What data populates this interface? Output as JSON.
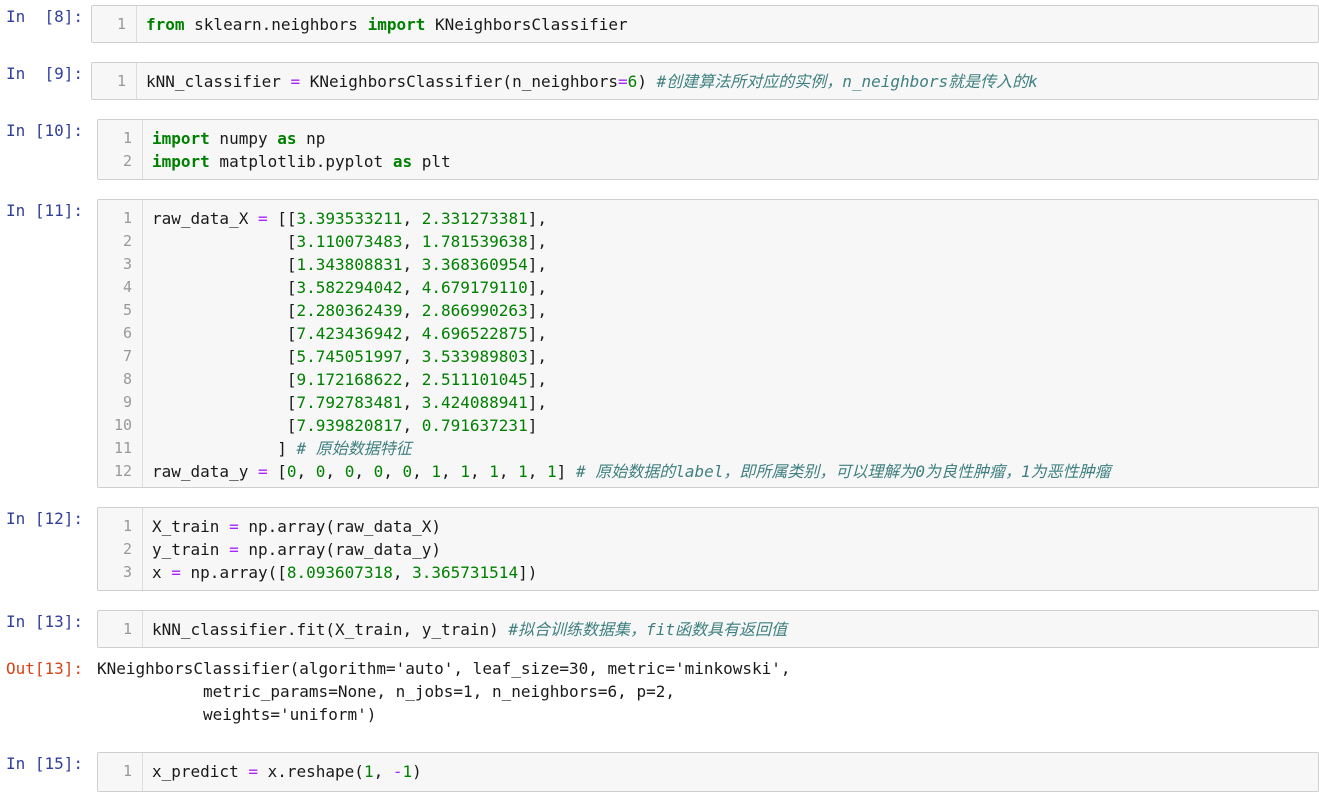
{
  "cells": [
    {
      "prompt": "In  [8]:",
      "lines": [
        [
          {
            "t": "kw",
            "v": "from"
          },
          {
            "t": "pl",
            "v": " sklearn.neighbors "
          },
          {
            "t": "kw",
            "v": "import"
          },
          {
            "t": "pl",
            "v": " KNeighborsClassifier"
          }
        ]
      ]
    },
    {
      "prompt": "In  [9]:",
      "lines": [
        [
          {
            "t": "pl",
            "v": "kNN_classifier "
          },
          {
            "t": "op",
            "v": "="
          },
          {
            "t": "pl",
            "v": " KNeighborsClassifier(n_neighbors"
          },
          {
            "t": "op",
            "v": "="
          },
          {
            "t": "num",
            "v": "6"
          },
          {
            "t": "pl",
            "v": ") "
          },
          {
            "t": "cm",
            "v": "#创建算法所对应的实例，n_neighbors就是传入的k"
          }
        ]
      ]
    },
    {
      "prompt": "In [10]:",
      "lines": [
        [
          {
            "t": "kw",
            "v": "import"
          },
          {
            "t": "pl",
            "v": " numpy "
          },
          {
            "t": "kw",
            "v": "as"
          },
          {
            "t": "pl",
            "v": " np"
          }
        ],
        [
          {
            "t": "kw",
            "v": "import"
          },
          {
            "t": "pl",
            "v": " matplotlib.pyplot "
          },
          {
            "t": "kw",
            "v": "as"
          },
          {
            "t": "pl",
            "v": " plt"
          }
        ]
      ]
    },
    {
      "prompt": "In [11]:",
      "lines": [
        [
          {
            "t": "pl",
            "v": "raw_data_X "
          },
          {
            "t": "op",
            "v": "="
          },
          {
            "t": "pl",
            "v": " [["
          },
          {
            "t": "num",
            "v": "3.393533211"
          },
          {
            "t": "pl",
            "v": ", "
          },
          {
            "t": "num",
            "v": "2.331273381"
          },
          {
            "t": "pl",
            "v": "],"
          }
        ],
        [
          {
            "t": "pl",
            "v": "              ["
          },
          {
            "t": "num",
            "v": "3.110073483"
          },
          {
            "t": "pl",
            "v": ", "
          },
          {
            "t": "num",
            "v": "1.781539638"
          },
          {
            "t": "pl",
            "v": "],"
          }
        ],
        [
          {
            "t": "pl",
            "v": "              ["
          },
          {
            "t": "num",
            "v": "1.343808831"
          },
          {
            "t": "pl",
            "v": ", "
          },
          {
            "t": "num",
            "v": "3.368360954"
          },
          {
            "t": "pl",
            "v": "],"
          }
        ],
        [
          {
            "t": "pl",
            "v": "              ["
          },
          {
            "t": "num",
            "v": "3.582294042"
          },
          {
            "t": "pl",
            "v": ", "
          },
          {
            "t": "num",
            "v": "4.679179110"
          },
          {
            "t": "pl",
            "v": "],"
          }
        ],
        [
          {
            "t": "pl",
            "v": "              ["
          },
          {
            "t": "num",
            "v": "2.280362439"
          },
          {
            "t": "pl",
            "v": ", "
          },
          {
            "t": "num",
            "v": "2.866990263"
          },
          {
            "t": "pl",
            "v": "],"
          }
        ],
        [
          {
            "t": "pl",
            "v": "              ["
          },
          {
            "t": "num",
            "v": "7.423436942"
          },
          {
            "t": "pl",
            "v": ", "
          },
          {
            "t": "num",
            "v": "4.696522875"
          },
          {
            "t": "pl",
            "v": "],"
          }
        ],
        [
          {
            "t": "pl",
            "v": "              ["
          },
          {
            "t": "num",
            "v": "5.745051997"
          },
          {
            "t": "pl",
            "v": ", "
          },
          {
            "t": "num",
            "v": "3.533989803"
          },
          {
            "t": "pl",
            "v": "],"
          }
        ],
        [
          {
            "t": "pl",
            "v": "              ["
          },
          {
            "t": "num",
            "v": "9.172168622"
          },
          {
            "t": "pl",
            "v": ", "
          },
          {
            "t": "num",
            "v": "2.511101045"
          },
          {
            "t": "pl",
            "v": "],"
          }
        ],
        [
          {
            "t": "pl",
            "v": "              ["
          },
          {
            "t": "num",
            "v": "7.792783481"
          },
          {
            "t": "pl",
            "v": ", "
          },
          {
            "t": "num",
            "v": "3.424088941"
          },
          {
            "t": "pl",
            "v": "],"
          }
        ],
        [
          {
            "t": "pl",
            "v": "              ["
          },
          {
            "t": "num",
            "v": "7.939820817"
          },
          {
            "t": "pl",
            "v": ", "
          },
          {
            "t": "num",
            "v": "0.791637231"
          },
          {
            "t": "pl",
            "v": "]"
          }
        ],
        [
          {
            "t": "pl",
            "v": "             ] "
          },
          {
            "t": "cm",
            "v": "# 原始数据特征"
          }
        ],
        [
          {
            "t": "pl",
            "v": "raw_data_y "
          },
          {
            "t": "op",
            "v": "="
          },
          {
            "t": "pl",
            "v": " ["
          },
          {
            "t": "num",
            "v": "0"
          },
          {
            "t": "pl",
            "v": ", "
          },
          {
            "t": "num",
            "v": "0"
          },
          {
            "t": "pl",
            "v": ", "
          },
          {
            "t": "num",
            "v": "0"
          },
          {
            "t": "pl",
            "v": ", "
          },
          {
            "t": "num",
            "v": "0"
          },
          {
            "t": "pl",
            "v": ", "
          },
          {
            "t": "num",
            "v": "0"
          },
          {
            "t": "pl",
            "v": ", "
          },
          {
            "t": "num",
            "v": "1"
          },
          {
            "t": "pl",
            "v": ", "
          },
          {
            "t": "num",
            "v": "1"
          },
          {
            "t": "pl",
            "v": ", "
          },
          {
            "t": "num",
            "v": "1"
          },
          {
            "t": "pl",
            "v": ", "
          },
          {
            "t": "num",
            "v": "1"
          },
          {
            "t": "pl",
            "v": ", "
          },
          {
            "t": "num",
            "v": "1"
          },
          {
            "t": "pl",
            "v": "] "
          },
          {
            "t": "cm",
            "v": "# 原始数据的label，即所属类别，可以理解为0为良性肿瘤，1为恶性肿瘤"
          }
        ]
      ]
    },
    {
      "prompt": "In [12]:",
      "lines": [
        [
          {
            "t": "pl",
            "v": "X_train "
          },
          {
            "t": "op",
            "v": "="
          },
          {
            "t": "pl",
            "v": " np.array(raw_data_X)"
          }
        ],
        [
          {
            "t": "pl",
            "v": "y_train "
          },
          {
            "t": "op",
            "v": "="
          },
          {
            "t": "pl",
            "v": " np.array(raw_data_y)"
          }
        ],
        [
          {
            "t": "pl",
            "v": "x "
          },
          {
            "t": "op",
            "v": "="
          },
          {
            "t": "pl",
            "v": " np.array(["
          },
          {
            "t": "num",
            "v": "8.093607318"
          },
          {
            "t": "pl",
            "v": ", "
          },
          {
            "t": "num",
            "v": "3.365731514"
          },
          {
            "t": "pl",
            "v": "])"
          }
        ]
      ]
    },
    {
      "prompt": "In [13]:",
      "lines": [
        [
          {
            "t": "pl",
            "v": "kNN_classifier.fit(X_train, y_train) "
          },
          {
            "t": "cm",
            "v": "#拟合训练数据集，fit函数具有返回值"
          }
        ]
      ],
      "output_prompt": "Out[13]:",
      "output": [
        "KNeighborsClassifier(algorithm='auto', leaf_size=30, metric='minkowski',",
        "           metric_params=None, n_jobs=1, n_neighbors=6, p=2,",
        "           weights='uniform')"
      ]
    },
    {
      "prompt": "In [15]:",
      "lines": [
        [
          {
            "t": "pl",
            "v": "x_predict "
          },
          {
            "t": "op",
            "v": "="
          },
          {
            "t": "pl",
            "v": " x.reshape("
          },
          {
            "t": "num",
            "v": "1"
          },
          {
            "t": "pl",
            "v": ", "
          },
          {
            "t": "op",
            "v": "-"
          },
          {
            "t": "num",
            "v": "1"
          },
          {
            "t": "pl",
            "v": ")"
          }
        ]
      ]
    }
  ]
}
